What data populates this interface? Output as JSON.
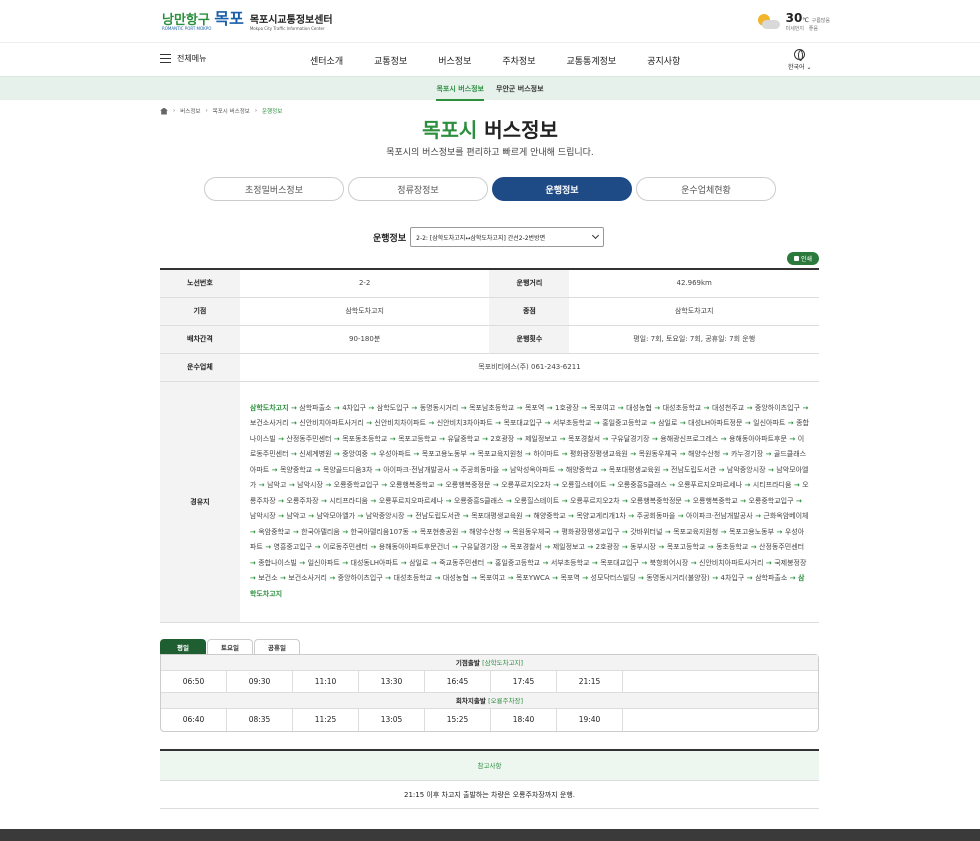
{
  "header": {
    "logo_slogan": "낭만항구 목포",
    "logo_slogan_a": "낭만항구",
    "logo_slogan_b": "목포",
    "logo_sub": "ROMANTIC PORT MOKPO",
    "site_title": "목포시교통정보센터",
    "site_title_en": "Mokpo City Traffic Information Center",
    "weather_temp": "30",
    "weather_unit": "℃",
    "weather_desc": "구름많음",
    "dust_label": "미세먼지",
    "dust_value": "좋음"
  },
  "nav": {
    "all_menu": "전체메뉴",
    "items": [
      "센터소개",
      "교통정보",
      "버스정보",
      "주차정보",
      "교통통계정보",
      "공지사항"
    ],
    "lang": "한국어"
  },
  "subnav": {
    "items": [
      "목포시 버스정보",
      "무안군 버스정보"
    ]
  },
  "breadcrumb": {
    "items": [
      "버스정보",
      "목포시 버스정보"
    ],
    "current": "운행정보"
  },
  "page": {
    "title_green": "목포시",
    "title_rest": "버스정보",
    "subtitle": "목포시의 버스정보를 편리하고 빠르게 안내해 드립니다."
  },
  "tabs": [
    "초정밀버스정보",
    "정류장정보",
    "운행정보",
    "운수업체현황"
  ],
  "route_select": {
    "label": "운행정보",
    "value": "2-2: [삼학도차고지↔삼학도차고지] 간선2-2번방면"
  },
  "print_label": "인쇄",
  "info": {
    "route_no_label": "노선번호",
    "route_no": "2-2",
    "distance_label": "운행거리",
    "distance": "42.969km",
    "start_label": "기점",
    "start": "삼학도차고지",
    "end_label": "종점",
    "end": "삼학도차고지",
    "interval_label": "배차간격",
    "interval": "90-180분",
    "trips_label": "운행횟수",
    "trips": "평일: 7회, 토요일: 7회, 공휴일: 7회 운행",
    "company_label": "운수업체",
    "company": "목포비티에스(주) 061-243-6211",
    "via_label": "경유지"
  },
  "stops": [
    "삼학도차고지",
    "삼학파출소",
    "4차입구",
    "삼학도입구",
    "동명동시거리",
    "목포남초등학교",
    "목포역",
    "1호광장",
    "목포여고",
    "대성농협",
    "대성초등학교",
    "대성천주교",
    "중앙하이츠입구",
    "보건소사거리",
    "신안비치아파트사거리",
    "신안비치차이파트",
    "신안비치3차아파트",
    "목포대교입구",
    "서부초등학교",
    "홍일중고등학교",
    "삼일로",
    "대성LH아파트정문",
    "일신아파트",
    "종합나이스빌",
    "산정동주민센터",
    "목포동초등학교",
    "목포고등학교",
    "유달중학교",
    "2호광장",
    "제일정보고",
    "목포경찰서",
    "구유달경기장",
    "용해광신프로그레스",
    "용해동아아파트후문",
    "이로동주민센터",
    "신세계병원",
    "중앙여중",
    "우성아파트",
    "목포고용노동부",
    "목포교육지원청",
    "하이마트",
    "평화광장평생교육원",
    "목원동우체국",
    "해양수산청",
    "카누경기장",
    "골드클래스아파트",
    "목양중학교",
    "목양골드디움3차",
    "아이파크·전남개발공사",
    "주공회동마을",
    "남악성옥아파트",
    "해양중학교",
    "목포대평생교육원",
    "전남도립도서관",
    "남악중앙시장",
    "남악모아엘가",
    "남악고",
    "남악시장",
    "오룡중학교입구",
    "오룡행복중학교",
    "오룡행복중정문",
    "오룡푸르지오2차",
    "오룡힐스테이트",
    "오룡중흥S클래스",
    "오룡푸르지오파르세나",
    "시티프라디움",
    "오룡주차장",
    "오룡주차장",
    "시티프라디움",
    "오룡푸르지오파르세나",
    "오룡중흥S클래스",
    "오룡힐스테이트",
    "오룡푸르지오2차",
    "오룡행복중학정문",
    "오룡행복중학교",
    "오룡중학교입구",
    "남악시장",
    "남악고",
    "남악모아엘가",
    "남악중앙시장",
    "전남도립도서관",
    "목포대평생교육원",
    "해양중학교",
    "목양교게리개1차",
    "주공회동마을",
    "아이파크·전남개발공사",
    "근화옥암베이체",
    "옥암중학교",
    "한국아델리움",
    "한국아델리움107동",
    "목포현충공원",
    "해양수산청",
    "목원동우체국",
    "평화광장평생교입구",
    "갓바위터널",
    "목포교육지원청",
    "목포고용노동부",
    "우성아파트",
    "영흥중고입구",
    "이로동주민센터",
    "용해동아아파트후문건너",
    "구유달경기장",
    "목포경찰서",
    "제일정보고",
    "2호광장",
    "동부시장",
    "목포고등학교",
    "동초등학교",
    "산정동주민센터",
    "종합나이스빌",
    "일신아파트",
    "대성동LH아파트",
    "삼일로",
    "죽교동주민센터",
    "홍일중고등학교",
    "서부초등학교",
    "목포대교입구",
    "북항회어시장",
    "신안비치아파트사거리",
    "국제봉정장",
    "보건소",
    "보건소사거리",
    "중앙하이츠입구",
    "대성초등학교",
    "대성농협",
    "목포여고",
    "목포YWCA",
    "목포역",
    "성모닥터스빌딩",
    "동명동시거리(불양장)",
    "4차입구",
    "삼학파출소",
    "삼학도차고지"
  ],
  "day_tabs": [
    "평일",
    "토요일",
    "공휴일"
  ],
  "schedule": {
    "from_start_label": "기점출발",
    "from_start_place": "[삼학도차고지]",
    "from_start_times": [
      "06:50",
      "09:30",
      "11:10",
      "13:30",
      "16:45",
      "17:45",
      "21:15"
    ],
    "from_garage_label": "회차지출발",
    "from_garage_place": "[오룡주차장]",
    "from_garage_times": [
      "06:40",
      "08:35",
      "11:25",
      "13:05",
      "15:25",
      "18:40",
      "19:40"
    ]
  },
  "note": {
    "title": "참고사항",
    "text": "21:15 이후 차고지 출발하는 차량은 오룡주차장까지 운행."
  }
}
